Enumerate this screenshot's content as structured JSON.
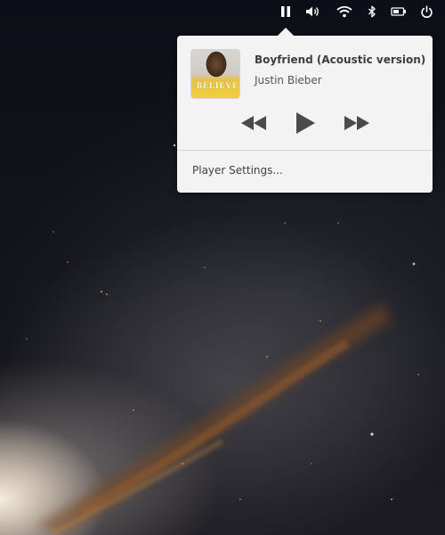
{
  "top_panel": {
    "indicators": [
      {
        "id": "media",
        "icon": "pause-icon"
      },
      {
        "id": "sound",
        "icon": "volume-icon"
      },
      {
        "id": "network",
        "icon": "wifi-icon"
      },
      {
        "id": "bluetooth",
        "icon": "bluetooth-icon"
      },
      {
        "id": "power",
        "icon": "battery-icon"
      },
      {
        "id": "session",
        "icon": "power-icon"
      }
    ]
  },
  "media_popover": {
    "track_title": "Boyfriend (Acoustic version)",
    "artist": "Justin Bieber",
    "album_art_logo": "BELIEVE",
    "controls": {
      "previous": "previous-icon",
      "play": "play-icon",
      "next": "next-icon"
    },
    "settings_label": "Player Settings..."
  },
  "colors": {
    "popover_bg": "#f3f3f3",
    "control_color": "#4a4a4a",
    "title_color": "#3d3d3d"
  }
}
